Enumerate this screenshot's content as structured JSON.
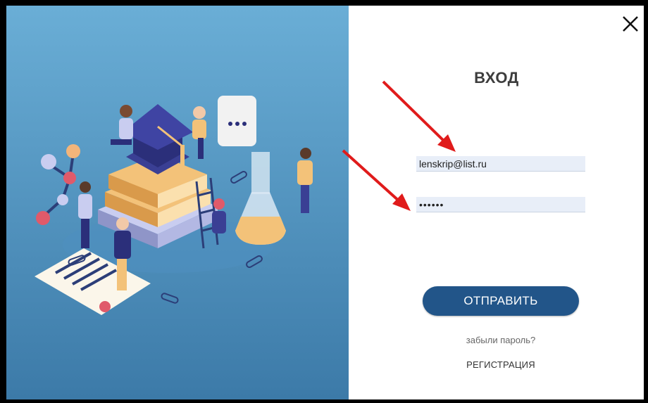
{
  "dialog": {
    "title": "ВХОД",
    "close_icon": "close-icon",
    "email": {
      "value": "lenskrip@list.ru"
    },
    "password": {
      "value": "••••••"
    },
    "submit_label": "ОТПРАВИТЬ",
    "forgot_label": "забыли пароль?",
    "register_label": "РЕГИСТРАЦИЯ"
  },
  "illustration": {
    "subject": "education-illustration"
  },
  "annotations": {
    "arrow_color": "#e01b1b"
  },
  "colors": {
    "accent": "#225589",
    "panel_top": "#6aaed6",
    "panel_bottom": "#3f7fae"
  }
}
